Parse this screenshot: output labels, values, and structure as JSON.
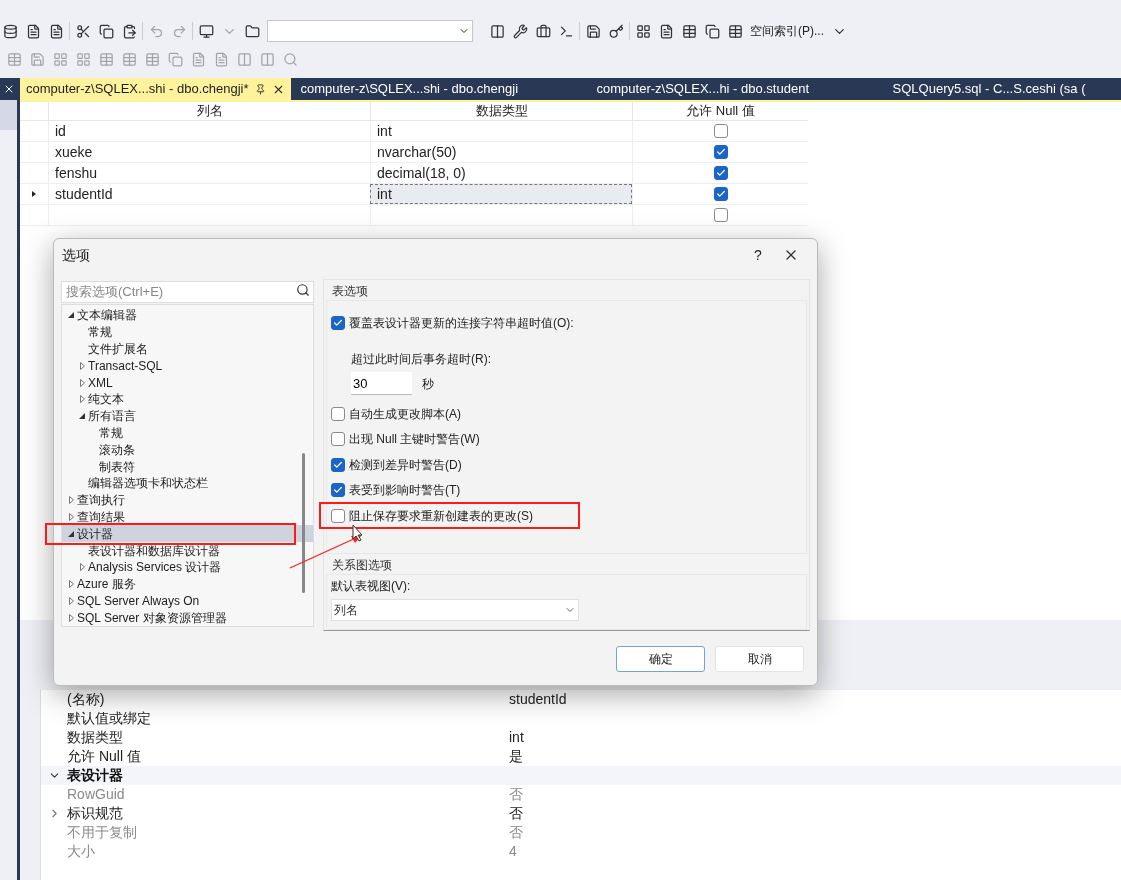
{
  "toolbar": {
    "button_label": "空间索引(P)..."
  },
  "tabs": [
    {
      "label": "computer-z\\SQLEX...shi - dbo.chengji*",
      "selected": true
    },
    {
      "label": "computer-z\\SQLEX...shi - dbo.chengji",
      "selected": false
    },
    {
      "label": "computer-z\\SQLEX...hi - dbo.student",
      "selected": false
    },
    {
      "label": "SQLQuery5.sql - C...S.ceshi (sa (",
      "selected": false
    }
  ],
  "grid": {
    "columns": [
      "列名",
      "数据类型",
      "允许 Null 值"
    ],
    "rows": [
      {
        "name": "id",
        "type": "int",
        "allow_null": false,
        "current": false
      },
      {
        "name": "xueke",
        "type": "nvarchar(50)",
        "allow_null": true,
        "current": false
      },
      {
        "name": "fenshu",
        "type": "decimal(18, 0)",
        "allow_null": true,
        "current": false
      },
      {
        "name": "studentId",
        "type": "int",
        "allow_null": true,
        "current": true
      },
      {
        "allow_null": false,
        "current": false
      }
    ]
  },
  "properties": [
    {
      "kind": "row",
      "name": "(名称)",
      "value": "studentId",
      "disabled": false
    },
    {
      "kind": "row",
      "name": "默认值或绑定",
      "disabled": false
    },
    {
      "kind": "row",
      "name": "数据类型",
      "value": "int",
      "disabled": false
    },
    {
      "kind": "row",
      "name": "允许 Null 值",
      "value": "是",
      "disabled": false
    },
    {
      "kind": "category",
      "name": "表设计器",
      "expanded": true
    },
    {
      "kind": "row",
      "name": "RowGuid",
      "value": "否",
      "disabled": true
    },
    {
      "kind": "row",
      "name": "标识规范",
      "value": "否",
      "disabled": false,
      "expanded": false
    },
    {
      "kind": "row",
      "name": "不用于复制",
      "value": "否",
      "disabled": true
    },
    {
      "kind": "row",
      "name": "大小",
      "value": "4",
      "disabled": true
    }
  ],
  "dialog": {
    "title": "选项",
    "help": "?",
    "search": {
      "placeholder": "搜索选项(Ctrl+E)"
    },
    "tree": [
      {
        "label": "文本编辑器",
        "expanded": true,
        "selected": false,
        "children": [
          {
            "label": "常规",
            "selected": false
          },
          {
            "label": "文件扩展名",
            "selected": false
          },
          {
            "label": "Transact-SQL",
            "expanded": false,
            "selected": false
          },
          {
            "label": "XML",
            "expanded": false,
            "selected": false
          },
          {
            "label": "纯文本",
            "expanded": false,
            "selected": false
          },
          {
            "label": "所有语言",
            "expanded": true,
            "selected": false,
            "children": [
              {
                "label": "常规",
                "selected": false
              },
              {
                "label": "滚动条",
                "selected": false
              },
              {
                "label": "制表符",
                "selected": false
              }
            ]
          },
          {
            "label": "编辑器选项卡和状态栏",
            "selected": false
          }
        ]
      },
      {
        "label": "查询执行",
        "expanded": false,
        "selected": false
      },
      {
        "label": "查询结果",
        "expanded": false,
        "selected": false
      },
      {
        "label": "设计器",
        "expanded": true,
        "selected": true,
        "children": [
          {
            "label": "表设计器和数据库设计器",
            "selected": false
          },
          {
            "label": "Analysis Services 设计器",
            "expanded": false,
            "selected": false
          }
        ]
      },
      {
        "label": "Azure 服务",
        "expanded": false,
        "selected": false
      },
      {
        "label": "SQL Server Always On",
        "expanded": false,
        "selected": false
      },
      {
        "label": "SQL Server 对象资源管理器",
        "expanded": false,
        "selected": false
      }
    ],
    "table_options": {
      "title": "表选项",
      "override_timeout": {
        "label": "覆盖表设计器更新的连接字符串超时值(O):",
        "checked": true
      },
      "timeout_label": "超过此时间后事务超时(R):",
      "timeout_value": "30",
      "timeout_unit": "秒",
      "options": [
        {
          "label": "自动生成更改脚本(A)",
          "checked": false
        },
        {
          "label": "出现 Null 主键时警告(W)",
          "checked": false
        },
        {
          "label": "检测到差异时警告(D)",
          "checked": true
        },
        {
          "label": "表受到影响时警告(T)",
          "checked": true
        },
        {
          "label": "阻止保存要求重新创建表的更改(S)",
          "checked": false
        }
      ]
    },
    "diagram_options": {
      "title": "关系图选项",
      "view_label": "默认表视图(V):",
      "view_value": "列名"
    },
    "buttons": [
      {
        "label": "确定",
        "default": true
      },
      {
        "label": "取消",
        "default": false
      }
    ]
  }
}
